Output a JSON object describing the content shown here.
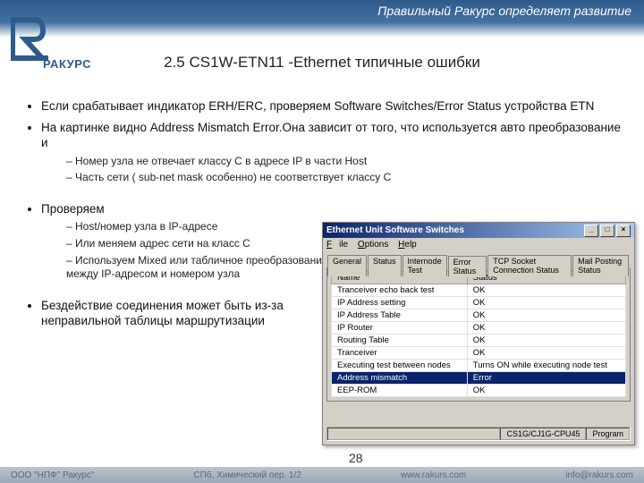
{
  "header": {
    "slogan": "Правильный Ракурс определяет развитие",
    "brand": "РАКУРС"
  },
  "title": "2.5 CS1W-ETN11 -Ethernet типичные ошибки",
  "bullets": {
    "b1": "Если срабатывает индикатор ERH/ERC, проверяем Software Switches/Error Status устройства ETN",
    "b2": "На картинке видно Address Mismatch Error.Она зависит от того, что используется авто преобразование и",
    "b2_d1": "Номер узла не отвечает классу С в адресе IP в части Host",
    "b2_d2": "Часть сети (  sub-net mask особенно) не соответствует классу С",
    "b3": "Проверяем",
    "b3_d1": "Host/номер узла в IP-адресе",
    "b3_d2": "Или меняем адрес сети на класс С",
    "b3_d3": "Используем Mixed или табличное преобразование между IP-адресом и номером узла",
    "b4": "Бездействие соединения может быть из-за неправильной таблицы маршрутизации"
  },
  "dialog": {
    "title": "Ethernet Unit Software Switches",
    "menu": {
      "file": "File",
      "options": "Options",
      "help": "Help"
    },
    "tabs": [
      "General",
      "Status",
      "Internode Test",
      "Error Status",
      "TCP Socket Connection Status",
      "Mail Posting Status"
    ],
    "active_tab": 3,
    "columns": {
      "name": "Name",
      "status": "Status"
    },
    "rows": [
      {
        "name": "Tranceiver echo back test",
        "status": "OK"
      },
      {
        "name": "IP Address setting",
        "status": "OK"
      },
      {
        "name": "IP Address Table",
        "status": "OK"
      },
      {
        "name": "IP Router",
        "status": "OK"
      },
      {
        "name": "Routing Table",
        "status": "OK"
      },
      {
        "name": "Tranceiver",
        "status": "OK"
      },
      {
        "name": "Executing test between nodes",
        "status": "Turns ON while executing node test"
      },
      {
        "name": "Address mismatch",
        "status": "Error",
        "selected": true
      },
      {
        "name": "EEP-ROM",
        "status": "OK"
      }
    ],
    "statusbar": {
      "device": "CS1G/CJ1G-CPU45",
      "mode": "Program"
    }
  },
  "page_number": "28",
  "footer": {
    "company": "ООО \"НПФ\" Ракурс\"",
    "address": "СПб, Химический пер. 1/2",
    "url": "www.rakurs.com",
    "email": "info@rakurs.com"
  }
}
